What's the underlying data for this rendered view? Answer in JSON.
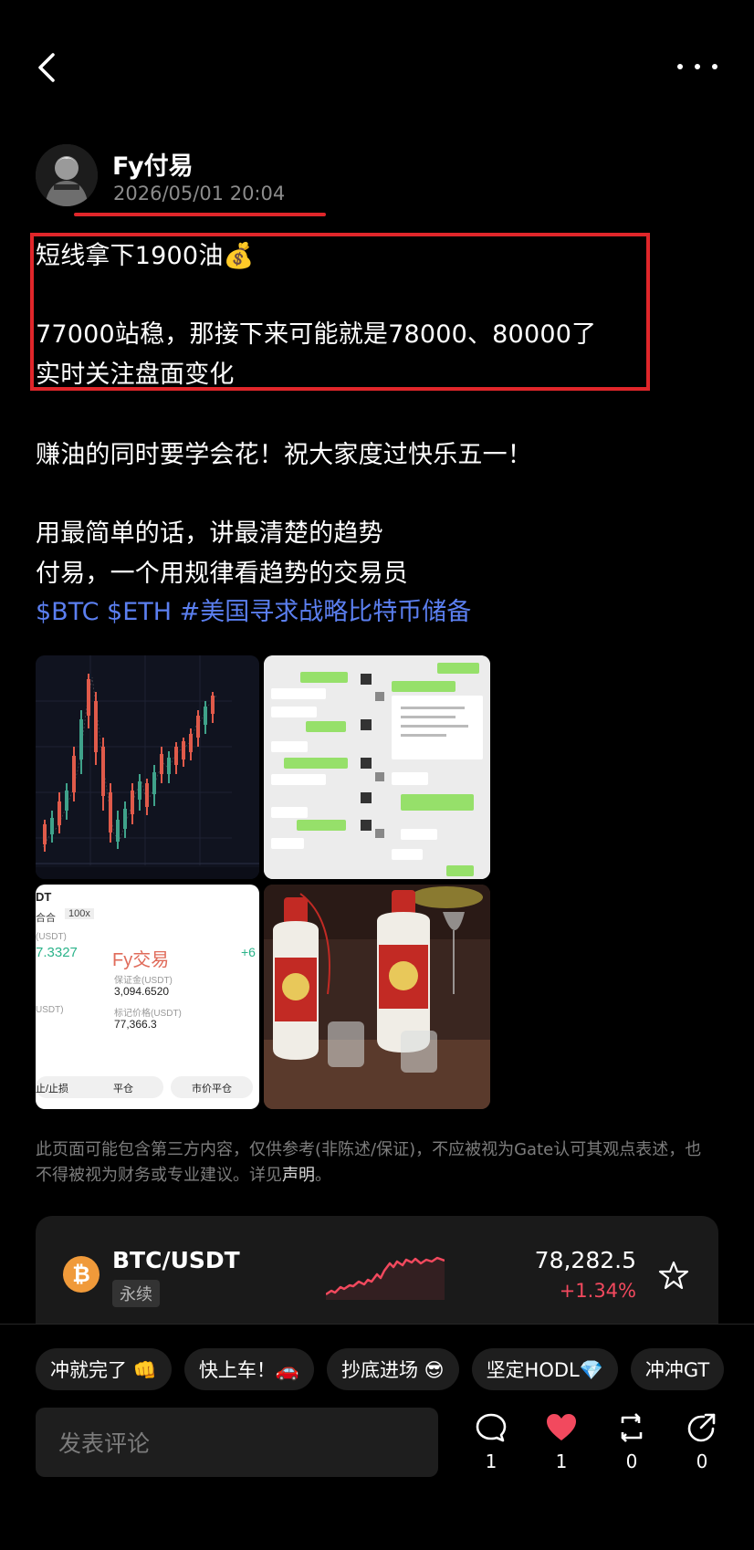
{
  "author": {
    "name": "Fy付易",
    "time": "2026/05/01 20:04"
  },
  "post": {
    "lines": [
      "短线拿下1900油💰",
      "77000站稳，那接下来可能就是78000、80000了",
      "实时关注盘面变化",
      "赚油的同时要学会花！祝大家度过快乐五一！",
      "用最简单的话，讲最清楚的趋势",
      "付易，一个用规律看趋势的交易员"
    ],
    "tags": "$BTC $ETH #美国寻求战略比特币储备"
  },
  "images": {
    "trade": {
      "header": "DT",
      "mode_a": "合合",
      "mode_b": "100x",
      "label_usdt": "(USDT)",
      "value_pnl": "7.3327",
      "watermark": "Fy交易",
      "pos_label": "+6",
      "margin_label": "保证金(USDT)",
      "margin_value": "3,094.6520",
      "mark_label": "标记价格(USDT)",
      "mark_value": "77,366.3",
      "left_label": "USDT)",
      "btn_1": "止/止损",
      "btn_2": "平仓",
      "btn_3": "市价平仓"
    }
  },
  "disclaimer": {
    "text": "此页面可能包含第三方内容，仅供参考(非陈述/保证)，不应被视为Gate认可其观点表述，也不得被视为财务或专业建议。详见",
    "link": "声明",
    "end": "。"
  },
  "ticker": {
    "coin_symbol": "₿",
    "pair": "BTC/USDT",
    "tag": "永续",
    "price": "78,282.5",
    "change": "+1.34%",
    "accent": "#f2495e"
  },
  "reactions": [
    "冲就完了 👊",
    "快上车！🚗",
    "抄底进场 😎",
    "坚定HODL💎",
    "冲冲GT"
  ],
  "comment": {
    "placeholder": "发表评论"
  },
  "actions": {
    "comment_count": "1",
    "like_count": "1",
    "repost_count": "0",
    "share_count": "0"
  }
}
